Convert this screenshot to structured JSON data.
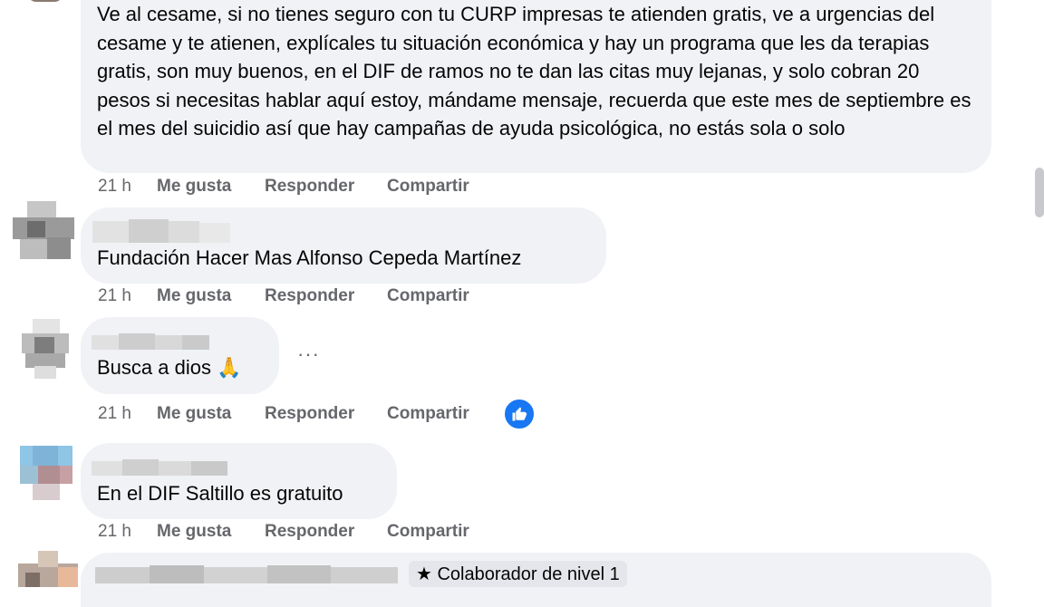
{
  "comments": [
    {
      "text": "Ve al cesame, si no tienes seguro con tu CURP impresas te atienden gratis, ve a urgencias del cesame y te atienen, explícales tu situación económica y hay un programa que les da terapias gratis, son muy buenos, en el DIF de ramos no te dan las citas muy lejanas, y solo cobran 20 pesos si necesitas hablar aquí estoy, mándame mensaje, recuerda que este mes de septiembre es el mes del suicidio así que hay campañas de ayuda psicológica, no estás sola o solo",
      "time": "21 h",
      "like": "Me gusta",
      "reply": "Responder",
      "share": "Compartir"
    },
    {
      "text": "Fundación Hacer Mas Alfonso Cepeda Martínez",
      "time": "21 h",
      "like": "Me gusta",
      "reply": "Responder",
      "share": "Compartir"
    },
    {
      "text": "Busca a dios 🙏",
      "time": "21 h",
      "like": "Me gusta",
      "reply": "Responder",
      "share": "Compartir",
      "more": "···"
    },
    {
      "text": "En el DIF Saltillo es gratuito",
      "time": "21 h",
      "like": "Me gusta",
      "reply": "Responder",
      "share": "Compartir"
    },
    {
      "badge": "★ Colaborador de nivel 1"
    }
  ],
  "colors": {
    "bubble": "#f0f2f5",
    "meta": "#65676b",
    "like": "#1877f2"
  },
  "icons": {
    "reaction": "thumbs-up-icon",
    "more": "more-options-icon"
  }
}
